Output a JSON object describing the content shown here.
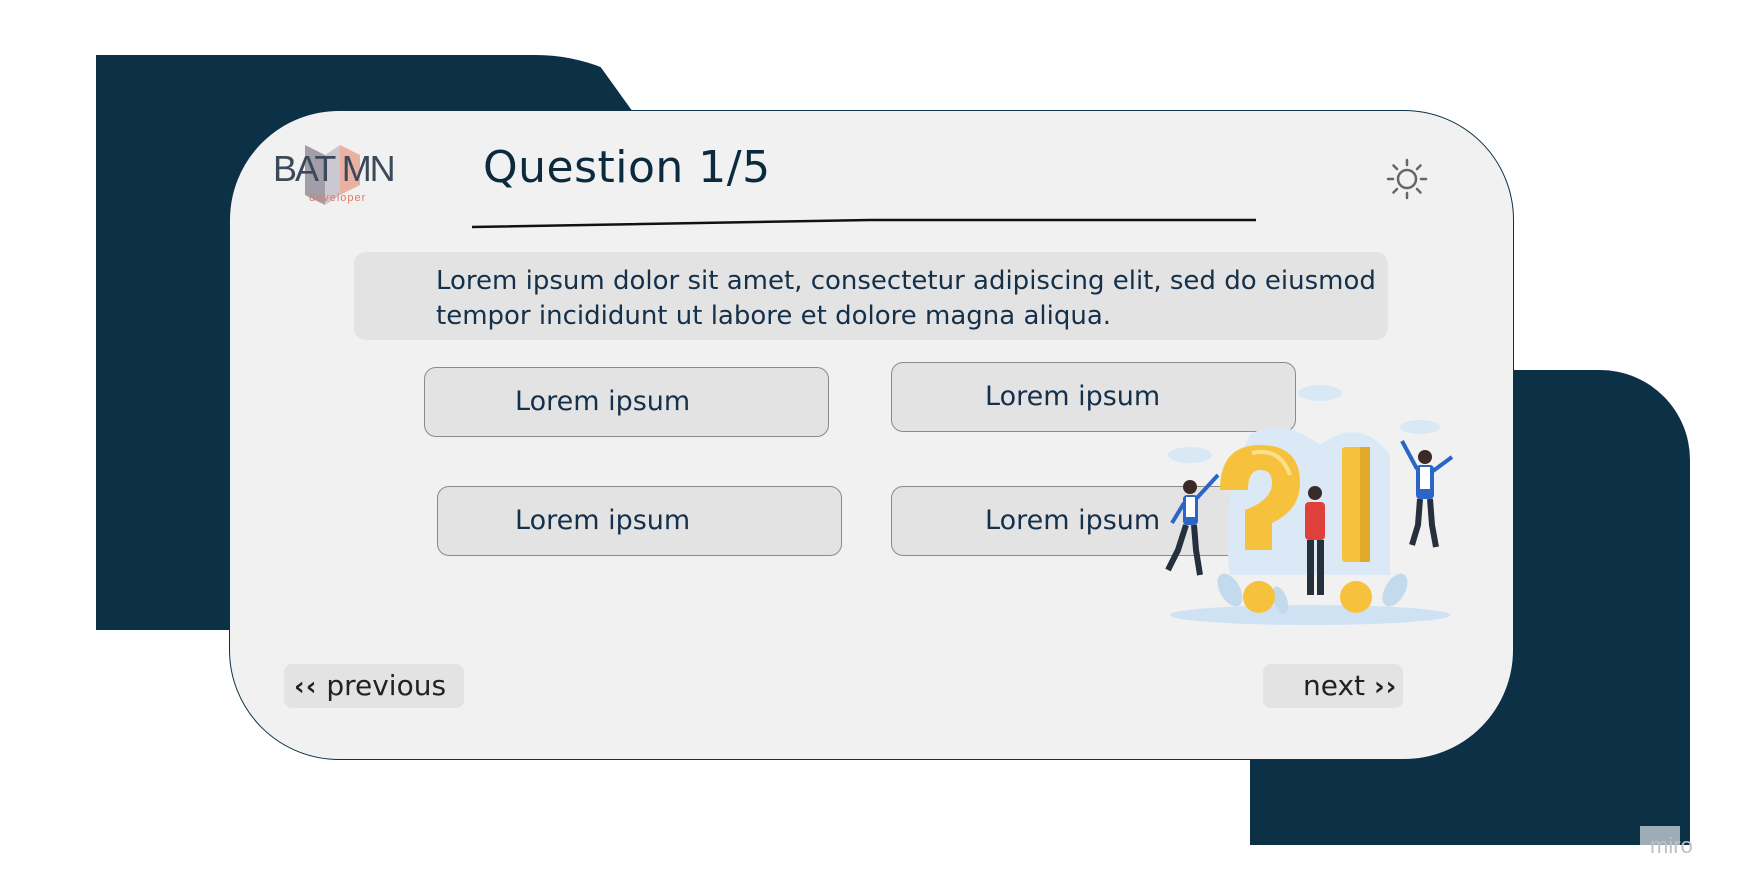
{
  "header": {
    "logo_text": "BAT MN",
    "logo_subtext": "developer",
    "title": "Question 1/5"
  },
  "question": {
    "text": "Lorem ipsum dolor sit amet, consectetur adipiscing elit, sed do eiusmod tempor incididunt ut labore et dolore magna aliqua."
  },
  "answers": [
    {
      "label": "Lorem ipsum"
    },
    {
      "label": "Lorem ipsum"
    },
    {
      "label": "Lorem ipsum"
    },
    {
      "label": "Lorem ipsum"
    }
  ],
  "navigation": {
    "previous_label": "previous",
    "next_label": "next",
    "previous_icon": "double-chevron-left-icon",
    "next_icon": "double-chevron-right-icon"
  },
  "icons": {
    "theme_toggle": "sun-icon",
    "illustration": "question-exclamation-illustration"
  },
  "watermark": "miro",
  "colors": {
    "primary_dark": "#0c3147",
    "card_bg": "#f1f1f1",
    "button_bg": "#e3e3e3",
    "text": "#15304a",
    "accent_yellow": "#f6c23e",
    "logo_accent": "#e07a6a"
  }
}
